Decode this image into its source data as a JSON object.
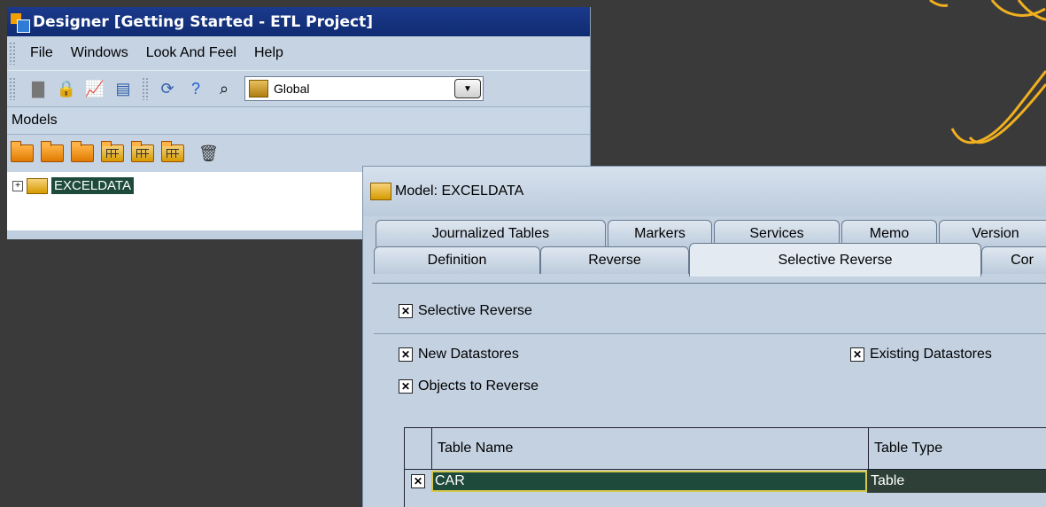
{
  "designer": {
    "title": "Designer [Getting Started - ETL Project]",
    "menu": [
      "File",
      "Windows",
      "Look And Feel",
      "Help"
    ],
    "context_combo": {
      "value": "Global"
    },
    "models_panel_title": "Models",
    "tree": [
      {
        "label": "EXCELDATA",
        "selected": true
      }
    ]
  },
  "model_dialog": {
    "title": "Model: EXCELDATA",
    "tabs_row1": [
      "Journalized Tables",
      "Markers",
      "Services",
      "Memo",
      "Version"
    ],
    "tabs_row2": [
      "Definition",
      "Reverse",
      "Selective Reverse",
      "Cor"
    ],
    "selected_tab": "Selective Reverse",
    "options": {
      "selective_reverse": {
        "label": "Selective Reverse",
        "checked": true
      },
      "new_datastores": {
        "label": "New Datastores",
        "checked": true
      },
      "existing_datastores": {
        "label": "Existing Datastores",
        "checked": true
      },
      "objects_to_reverse": {
        "label": "Objects to Reverse",
        "checked": true
      }
    },
    "table": {
      "columns": [
        "Table Name",
        "Table Type"
      ],
      "rows": [
        {
          "checked": true,
          "name": "CAR",
          "type": "Table"
        }
      ]
    }
  },
  "colors": {
    "title_bar": "#0f2b72",
    "window_bg": "#c5d3e3",
    "selection": "#1e4a3c",
    "selection_border": "#d4c94a",
    "desktop": "#3a3a3a",
    "deco_stroke": "#f0b020"
  }
}
